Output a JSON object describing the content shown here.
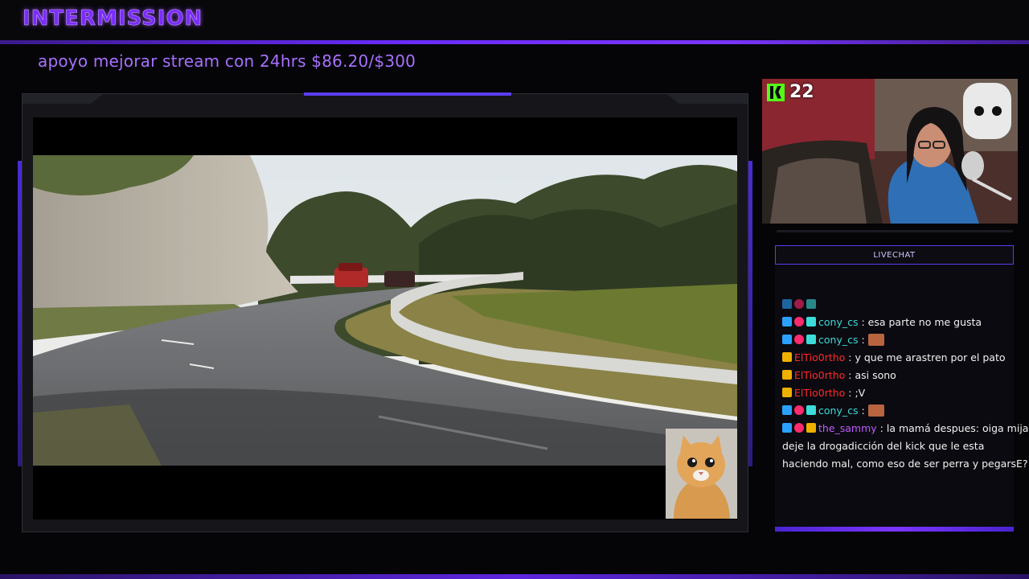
{
  "overlay": {
    "title": "INTERMISSION",
    "goal_text": "apoyo mejorar stream con 24hrs $86.20/$300",
    "accent_color": "#6a2cff"
  },
  "webcam": {
    "platform_icon": "kick-logo-icon",
    "viewer_count": "22"
  },
  "chat": {
    "header": "LIVECHAT",
    "messages": [
      {
        "user": "cony_cs",
        "user_color": "#3ddbd9",
        "text": " : esa parte no me gusta",
        "emote": false
      },
      {
        "user": "cony_cs",
        "user_color": "#3ddbd9",
        "text": " :",
        "emote": true
      },
      {
        "user": "ElTio0rtho",
        "user_color": "#ff2a2a",
        "text": " : y que me arastren por el pato",
        "emote": false
      },
      {
        "user": "ElTio0rtho",
        "user_color": "#ff2a2a",
        "text": " : asi sono",
        "emote": false
      },
      {
        "user": "ElTio0rtho",
        "user_color": "#ff2a2a",
        "text": " : ;V",
        "emote": false
      },
      {
        "user": "cony_cs",
        "user_color": "#3ddbd9",
        "text": " :",
        "emote": true
      },
      {
        "user": "the_sammy",
        "user_color": "#c15bff",
        "text": " : la mamá despues: oiga mija deje la drogadicción del kick que le esta haciendo mal, como eso de ser perra y pegarsE?",
        "emote": false
      }
    ]
  }
}
